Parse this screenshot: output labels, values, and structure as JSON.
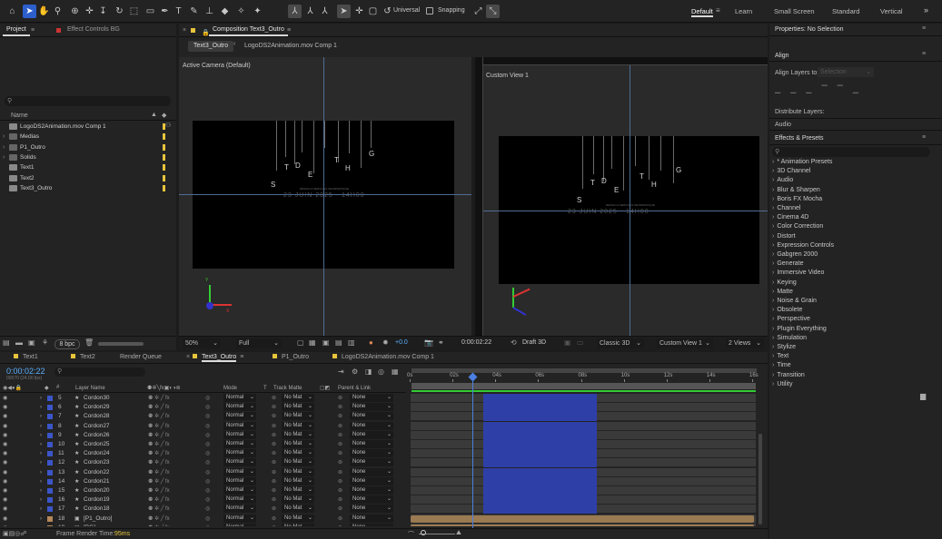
{
  "toolbar": {
    "universal_label": "Universal",
    "snapping_label": "Snapping",
    "workspaces": [
      "Default",
      "Learn",
      "Small Screen",
      "Standard",
      "Vertical"
    ]
  },
  "project_panel": {
    "tab_project": "Project",
    "tab_effect_controls": "Effect Controls BG",
    "search_placeholder": "",
    "column_name": "Name",
    "items": [
      {
        "name": "LogoDS2Animation.mov Comp 1",
        "type": "comp",
        "label_color": "#e8c43c"
      },
      {
        "name": "Medias",
        "type": "folder",
        "label_color": "#e8c43c"
      },
      {
        "name": "P1_Outro",
        "type": "folder",
        "label_color": "#e8c43c"
      },
      {
        "name": "Solids",
        "type": "folder",
        "label_color": "#e8c43c"
      },
      {
        "name": "Text1",
        "type": "comp",
        "label_color": "#e8c43c"
      },
      {
        "name": "Text2",
        "type": "comp",
        "label_color": "#e8c43c"
      },
      {
        "name": "Text3_Outro",
        "type": "comp",
        "label_color": "#e8c43c"
      }
    ],
    "bpc": "8 bpc"
  },
  "composition": {
    "title": "Composition Text3_Outro",
    "breadcrumb_active": "Text3_Outro",
    "breadcrumb_next": "LogoDS2Animation.mov Comp 1",
    "left_view_label": "Active Camera (Default)",
    "right_view_label": "Custom View 1",
    "letters": [
      "S",
      "T",
      "D",
      "E",
      "T",
      "H",
      "G"
    ],
    "sub_small": "DESIGN & SERVICES INFORMATIQUE",
    "date_text": "23 JUIN 2025 - 14H00",
    "status": {
      "zoom": "50%",
      "resolution": "Full",
      "exposure": "+0.0",
      "timecode": "0:00:02:22",
      "renderer_draft": "Draft 3D",
      "renderer": "Classic 3D",
      "view": "Custom View 1",
      "views_count": "2 Views"
    }
  },
  "properties": {
    "title": "Properties: No Selection",
    "align_title": "Align",
    "align_layers_to": "Align Layers to:",
    "align_target": "Selection",
    "distribute_label": "Distribute Layers:",
    "audio_label": "Audio"
  },
  "effects": {
    "title": "Effects & Presets",
    "search_placeholder": "",
    "items": [
      "* Animation Presets",
      "3D Channel",
      "Audio",
      "Blur & Sharpen",
      "Boris FX Mocha",
      "Channel",
      "Cinema 4D",
      "Color Correction",
      "Distort",
      "Expression Controls",
      "Gabgren 2000",
      "Generate",
      "Immersive Video",
      "Keying",
      "Matte",
      "Noise & Grain",
      "Obsolete",
      "Perspective",
      "Plugin Everything",
      "Simulation",
      "Stylize",
      "Text",
      "Time",
      "Transition",
      "Utility"
    ]
  },
  "timeline": {
    "tabs": [
      {
        "label": "Text1",
        "color": "#e8c43c",
        "active": false
      },
      {
        "label": "Text2",
        "color": "#e8c43c",
        "active": false
      },
      {
        "label": "Render Queue",
        "color": "",
        "active": false
      },
      {
        "label": "Text3_Outro",
        "color": "#e8c43c",
        "active": true
      },
      {
        "label": "P1_Outro",
        "color": "#e8c43c",
        "active": false
      },
      {
        "label": "LogoDS2Animation.mov Comp 1",
        "color": "#e8c43c",
        "active": false
      }
    ],
    "current_time": "0:00:02:22",
    "frame_info": "00070 (24.00 fps)",
    "columns": {
      "layer_name": "Layer Name",
      "mode": "Mode",
      "t": "T",
      "track_matte": "Track Matte",
      "parent": "Parent & Link"
    },
    "ruler": [
      "0s",
      "02s",
      "04s",
      "06s",
      "08s",
      "10s",
      "12s",
      "14s",
      "16s"
    ],
    "playhead_frac": 0.18,
    "layers": [
      {
        "num": "5",
        "name": "Cordon30",
        "mode": "Normal",
        "matte": "No Mat",
        "parent": "None",
        "color": "#3b55c9",
        "bar": "blue"
      },
      {
        "num": "6",
        "name": "Cordon29",
        "mode": "Normal",
        "matte": "No Mat",
        "parent": "None",
        "color": "#3b55c9",
        "bar": "blue"
      },
      {
        "num": "7",
        "name": "Cordon28",
        "mode": "Normal",
        "matte": "No Mat",
        "parent": "None",
        "color": "#3b55c9",
        "bar": "blue"
      },
      {
        "num": "8",
        "name": "Cordon27",
        "mode": "Normal",
        "matte": "No Mat",
        "parent": "None",
        "color": "#3b55c9",
        "bar": "blue"
      },
      {
        "num": "9",
        "name": "Cordon26",
        "mode": "Normal",
        "matte": "No Mat",
        "parent": "None",
        "color": "#3b55c9",
        "bar": "blue"
      },
      {
        "num": "10",
        "name": "Cordon25",
        "mode": "Normal",
        "matte": "No Mat",
        "parent": "None",
        "color": "#3b55c9",
        "bar": "blue"
      },
      {
        "num": "11",
        "name": "Cordon24",
        "mode": "Normal",
        "matte": "No Mat",
        "parent": "None",
        "color": "#3b55c9",
        "bar": "blue"
      },
      {
        "num": "12",
        "name": "Cordon23",
        "mode": "Normal",
        "matte": "No Mat",
        "parent": "None",
        "color": "#3b55c9",
        "bar": "blue"
      },
      {
        "num": "13",
        "name": "Cordon22",
        "mode": "Normal",
        "matte": "No Mat",
        "parent": "None",
        "color": "#3b55c9",
        "bar": "blue"
      },
      {
        "num": "14",
        "name": "Cordon21",
        "mode": "Normal",
        "matte": "No Mat",
        "parent": "None",
        "color": "#3b55c9",
        "bar": "blue"
      },
      {
        "num": "15",
        "name": "Cordon20",
        "mode": "Normal",
        "matte": "No Mat",
        "parent": "None",
        "color": "#3b55c9",
        "bar": "blue"
      },
      {
        "num": "16",
        "name": "Cordon19",
        "mode": "Normal",
        "matte": "No Mat",
        "parent": "None",
        "color": "#3b55c9",
        "bar": "blue"
      },
      {
        "num": "17",
        "name": "Cordon18",
        "mode": "Normal",
        "matte": "No Mat",
        "parent": "None",
        "color": "#3b55c9",
        "bar": "blue"
      },
      {
        "num": "18",
        "name": "[P1_Outro]",
        "mode": "Normal",
        "matte": "No Mat",
        "parent": "None",
        "color": "#b5875a",
        "bar": "tan"
      },
      {
        "num": "19",
        "name": "[BG]",
        "mode": "Normal",
        "matte": "No Mat",
        "parent": "None",
        "color": "#b5875a",
        "bar": "tan"
      }
    ],
    "bar_blue_start": 0.21,
    "bar_blue_end": 0.54,
    "footer_label": "Frame Render Time:",
    "footer_value": "95ms"
  }
}
